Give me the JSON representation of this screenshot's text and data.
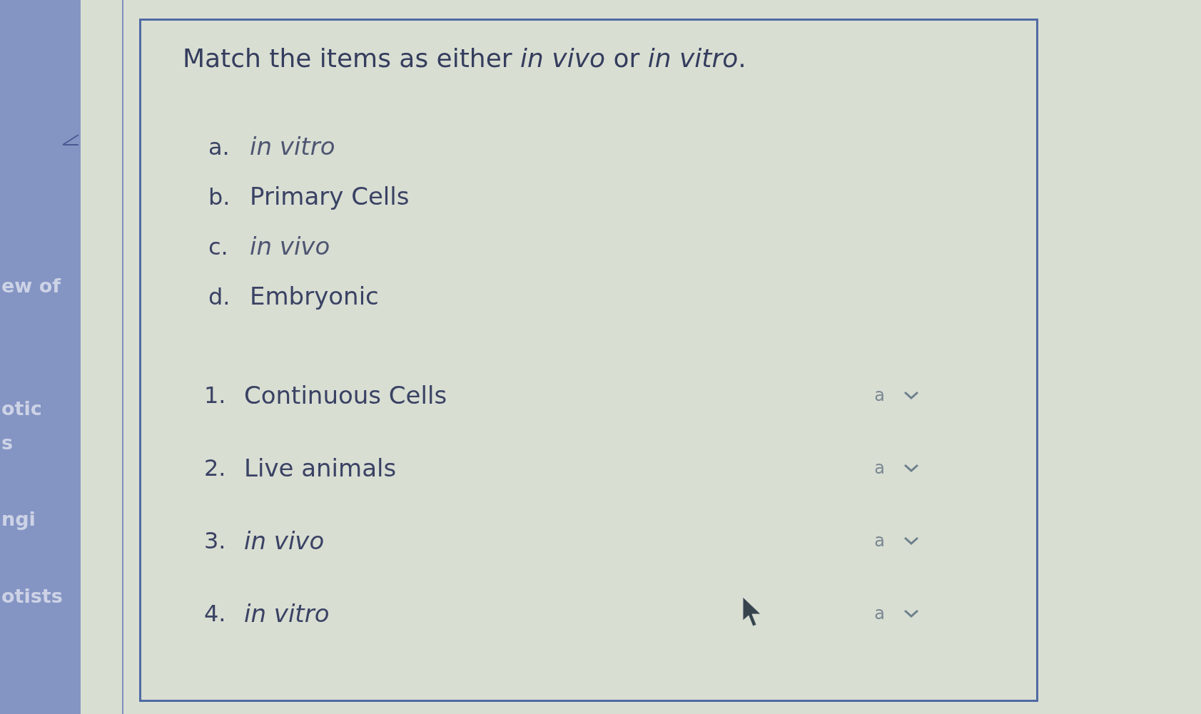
{
  "sidebar": {
    "items": [
      "ew of",
      "otic",
      "s",
      "ngi",
      "otists"
    ]
  },
  "question": {
    "prompt": "Match the items as either *in vivo* or *in vitro*.",
    "options": [
      {
        "letter": "a.",
        "text": "in vitro",
        "italic": true
      },
      {
        "letter": "b.",
        "text": "Primary Cells",
        "italic": false
      },
      {
        "letter": "c.",
        "text": "in vivo",
        "italic": true
      },
      {
        "letter": "d.",
        "text": "Embryonic",
        "italic": false
      }
    ],
    "matches": [
      {
        "number": "1.",
        "text": "Continuous Cells",
        "italic": false,
        "answer": "a"
      },
      {
        "number": "2.",
        "text": "Live animals",
        "italic": false,
        "answer": "a"
      },
      {
        "number": "3.",
        "text": "in vivo",
        "italic": true,
        "answer": "a"
      },
      {
        "number": "4.",
        "text": "in vitro",
        "italic": true,
        "answer": "a"
      }
    ]
  }
}
